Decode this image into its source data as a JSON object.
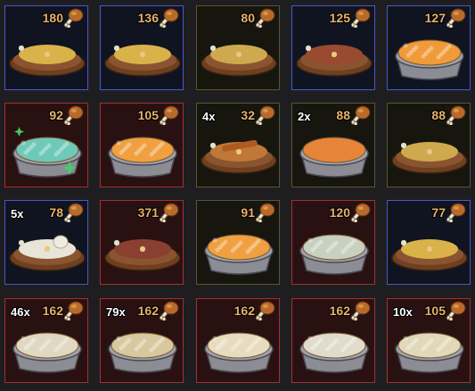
{
  "currency_icon": "drumstick-icon",
  "items": [
    {
      "price": "180",
      "count": "",
      "frame": "blue",
      "food": "mixed-dish",
      "tin": false,
      "fill": "#d9b24a"
    },
    {
      "price": "136",
      "count": "",
      "frame": "blue",
      "food": "mixed-dish",
      "tin": false,
      "fill": "#d9b24a"
    },
    {
      "price": "80",
      "count": "",
      "frame": "dark",
      "food": "mixed-dish",
      "tin": false,
      "fill": "#cfa94e"
    },
    {
      "price": "125",
      "count": "",
      "frame": "blue",
      "food": "meat-dish",
      "tin": false,
      "fill": "#9a4a30"
    },
    {
      "price": "127",
      "count": "",
      "frame": "blue",
      "food": "pie",
      "tin": true,
      "fill": "#f09a3a"
    },
    {
      "price": "92",
      "count": "",
      "frame": "red",
      "food": "sparkle-pie",
      "tin": true,
      "fill": "#6ec9b8"
    },
    {
      "price": "105",
      "count": "",
      "frame": "red",
      "food": "pie",
      "tin": true,
      "fill": "#f0a040"
    },
    {
      "price": "32",
      "count": "4x",
      "frame": "dark",
      "food": "kebab-dish",
      "tin": false,
      "fill": "#c07838"
    },
    {
      "price": "88",
      "count": "2x",
      "frame": "dark",
      "food": "plain-pie",
      "tin": true,
      "fill": "#e8843a"
    },
    {
      "price": "88",
      "count": "",
      "frame": "dark",
      "food": "mixed-dish",
      "tin": false,
      "fill": "#cfa94e"
    },
    {
      "price": "78",
      "count": "5x",
      "frame": "blue",
      "food": "dumpling-dish",
      "tin": false,
      "fill": "#e8e4d8"
    },
    {
      "price": "371",
      "count": "",
      "frame": "red",
      "food": "dark-meat-dish",
      "tin": false,
      "fill": "#8a4030"
    },
    {
      "price": "91",
      "count": "",
      "frame": "dark",
      "food": "pie",
      "tin": true,
      "fill": "#f0a040"
    },
    {
      "price": "120",
      "count": "",
      "frame": "red",
      "food": "pie",
      "tin": true,
      "fill": "#c8d0c0"
    },
    {
      "price": "77",
      "count": "",
      "frame": "blue",
      "food": "mixed-dish",
      "tin": false,
      "fill": "#d9b24a"
    },
    {
      "price": "162",
      "count": "46x",
      "frame": "red",
      "food": "pie",
      "tin": true,
      "fill": "#e0d8c0"
    },
    {
      "price": "162",
      "count": "79x",
      "frame": "red",
      "food": "pie",
      "tin": true,
      "fill": "#d8c8a0"
    },
    {
      "price": "162",
      "count": "",
      "frame": "red",
      "food": "pie",
      "tin": true,
      "fill": "#e8dcc0"
    },
    {
      "price": "162",
      "count": "",
      "frame": "red",
      "food": "pie",
      "tin": true,
      "fill": "#e0dccc"
    },
    {
      "price": "105",
      "count": "10x",
      "frame": "red",
      "food": "pie",
      "tin": true,
      "fill": "#e0d8b8"
    }
  ]
}
